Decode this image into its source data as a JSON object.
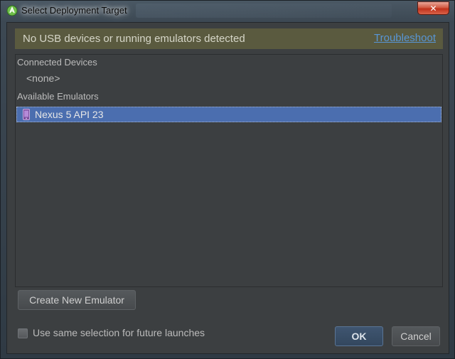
{
  "window": {
    "title": "Select Deployment Target",
    "close_symbol": "✕"
  },
  "banner": {
    "message": "No USB devices or running emulators detected",
    "link": "Troubleshoot"
  },
  "connected_devices": {
    "header": "Connected Devices",
    "empty_text": "<none>"
  },
  "available_emulators": {
    "header": "Available Emulators",
    "items": [
      {
        "label": "Nexus 5 API 23",
        "icon": "phone-icon",
        "selected": true
      }
    ]
  },
  "buttons": {
    "create_emulator": "Create New Emulator",
    "ok": "OK",
    "cancel": "Cancel"
  },
  "options": {
    "same_selection_label": "Use same selection for future launches",
    "same_selection_checked": false
  },
  "colors": {
    "banner_bg": "#5a5a3f",
    "selection_bg": "#4b6eaf",
    "dialog_bg": "#3c3f41",
    "link": "#5896d6"
  }
}
